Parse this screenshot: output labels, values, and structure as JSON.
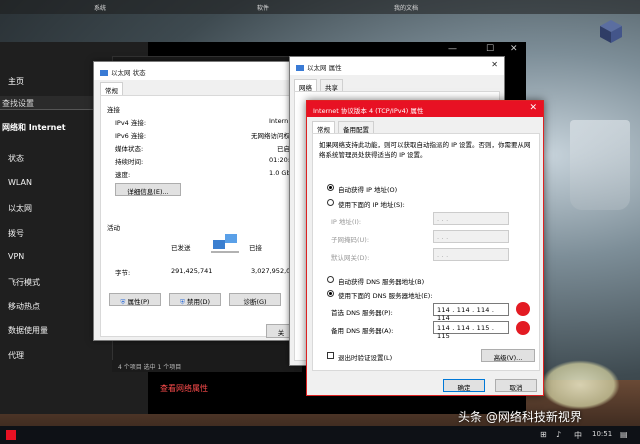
{
  "top_strip": {
    "items": [
      "系统",
      "软件",
      "我的文档"
    ]
  },
  "settings": {
    "home": "主页",
    "search_placeholder": "查找设置",
    "category": "网络和 Internet",
    "nav": [
      "状态",
      "WLAN",
      "以太网",
      "拨号",
      "VPN",
      "飞行模式",
      "移动热点",
      "数据使用量",
      "代理"
    ],
    "link": "查看网络属性"
  },
  "explorer": {
    "status": "4 个项目    选中 1 个项目"
  },
  "status_window": {
    "title": "以太网 状态",
    "tab": "常规",
    "connection_header": "连接",
    "rows": [
      {
        "label": "IPv4 连接:",
        "value": "Intern"
      },
      {
        "label": "IPv6 连接:",
        "value": "无网络访问权"
      },
      {
        "label": "媒体状态:",
        "value": "已启"
      },
      {
        "label": "持续时间:",
        "value": "01:20:"
      },
      {
        "label": "速度:",
        "value": "1.0 Gb"
      }
    ],
    "details_button": "详细信息(E)...",
    "activity_header": "活动",
    "sent_label": "已发送",
    "received_label": "已接",
    "bytes_label": "字节:",
    "bytes_sent": "291,425,741",
    "bytes_received": "3,027,952,0",
    "properties_button": "属性(P)",
    "disable_button": "禁用(D)",
    "diagnose_button": "诊断(G)",
    "close_button": "关"
  },
  "props_window": {
    "title": "以太网 属性",
    "tabs": [
      "网络",
      "共享"
    ]
  },
  "ipv4_dialog": {
    "title": "Internet 协议版本 4 (TCP/IPv4) 属性",
    "tabs": [
      "常规",
      "备用配置"
    ],
    "description": "如果网络支持此功能，则可以获取自动指派的 IP 设置。否则，你需要从网络系统管理员处获得适当的 IP 设置。",
    "auto_ip": "自动获得 IP 地址(O)",
    "manual_ip": "使用下面的 IP 地址(S):",
    "ip_label": "IP 地址(I):",
    "mask_label": "子网掩码(U):",
    "gateway_label": "默认网关(D):",
    "empty_ip": ".        .        .",
    "auto_dns": "自动获得 DNS 服务器地址(B)",
    "manual_dns": "使用下面的 DNS 服务器地址(E):",
    "preferred_dns_label": "首选 DNS 服务器(P):",
    "preferred_dns_value": "114 . 114 . 114 . 114",
    "alternate_dns_label": "备用 DNS 服务器(A):",
    "alternate_dns_value": "114 . 114 . 115 . 115",
    "validate_label": "退出时验证设置(L)",
    "advanced_button": "高级(V)...",
    "ok_button": "确定",
    "cancel_button": "取消"
  },
  "taskbar": {
    "time": "10:51"
  },
  "watermark": "头条 @网络科技新视界"
}
